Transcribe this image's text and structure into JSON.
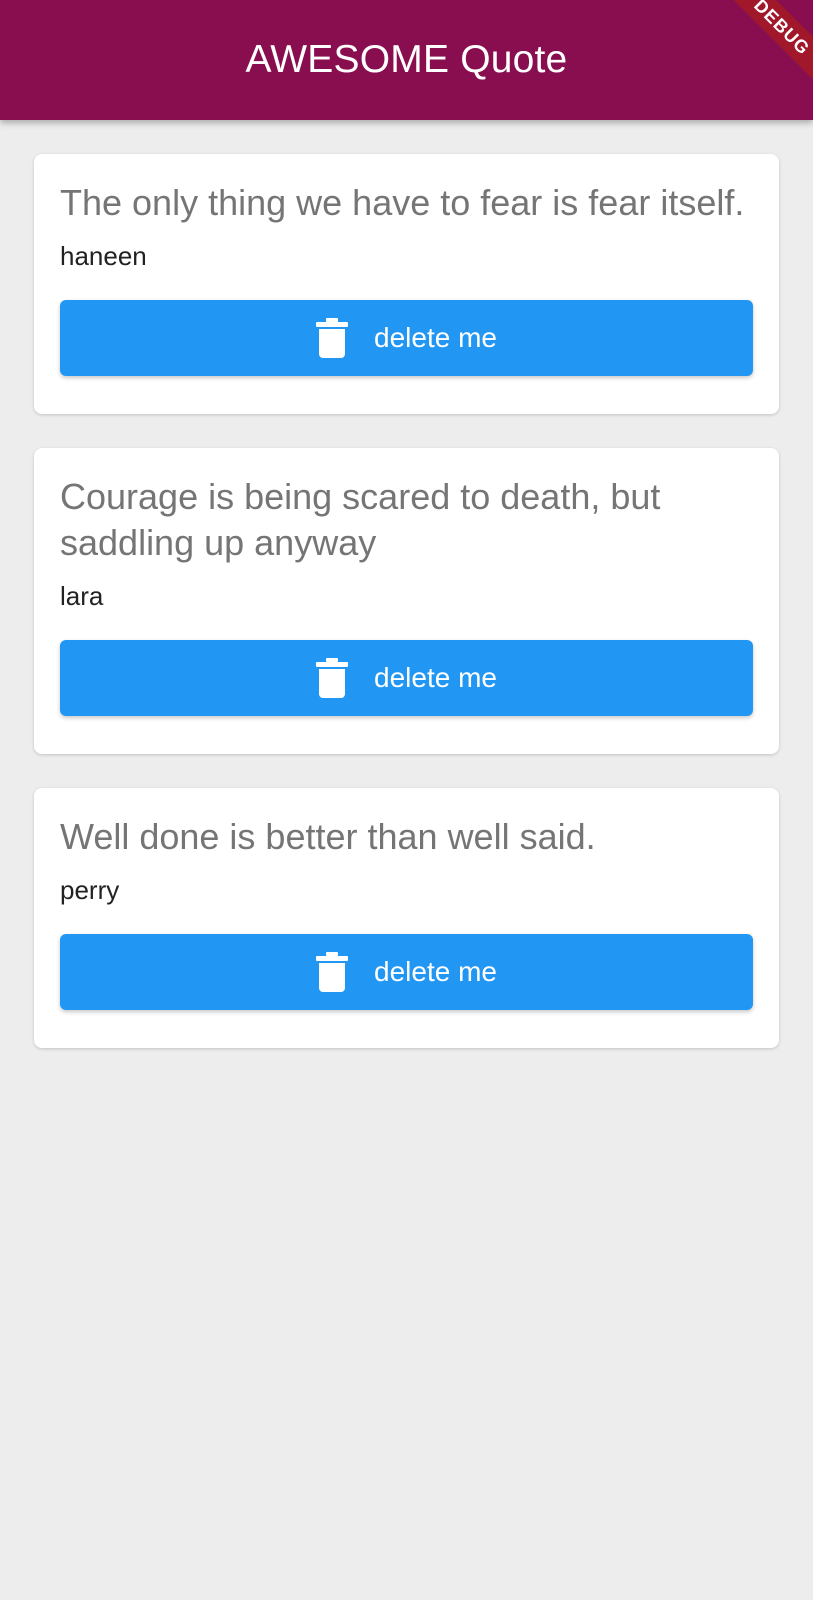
{
  "app_bar": {
    "title": "AWESOME Quote",
    "debug_banner": "DEBUG",
    "background": "#880e4f"
  },
  "quotes": [
    {
      "text": "The only thing we have to fear is fear itself.",
      "author": "haneen",
      "button_label": "delete me",
      "button_icon": "trash-icon"
    },
    {
      "text": "Courage is being scared to death, but saddling up anyway",
      "author": "lara",
      "button_label": "delete me",
      "button_icon": "trash-icon"
    },
    {
      "text": "Well done is better than well said.",
      "author": "perry",
      "button_label": "delete me",
      "button_icon": "trash-icon"
    }
  ],
  "colors": {
    "button": "#2196f3",
    "page_background": "#ededed",
    "quote_text": "#757575"
  }
}
